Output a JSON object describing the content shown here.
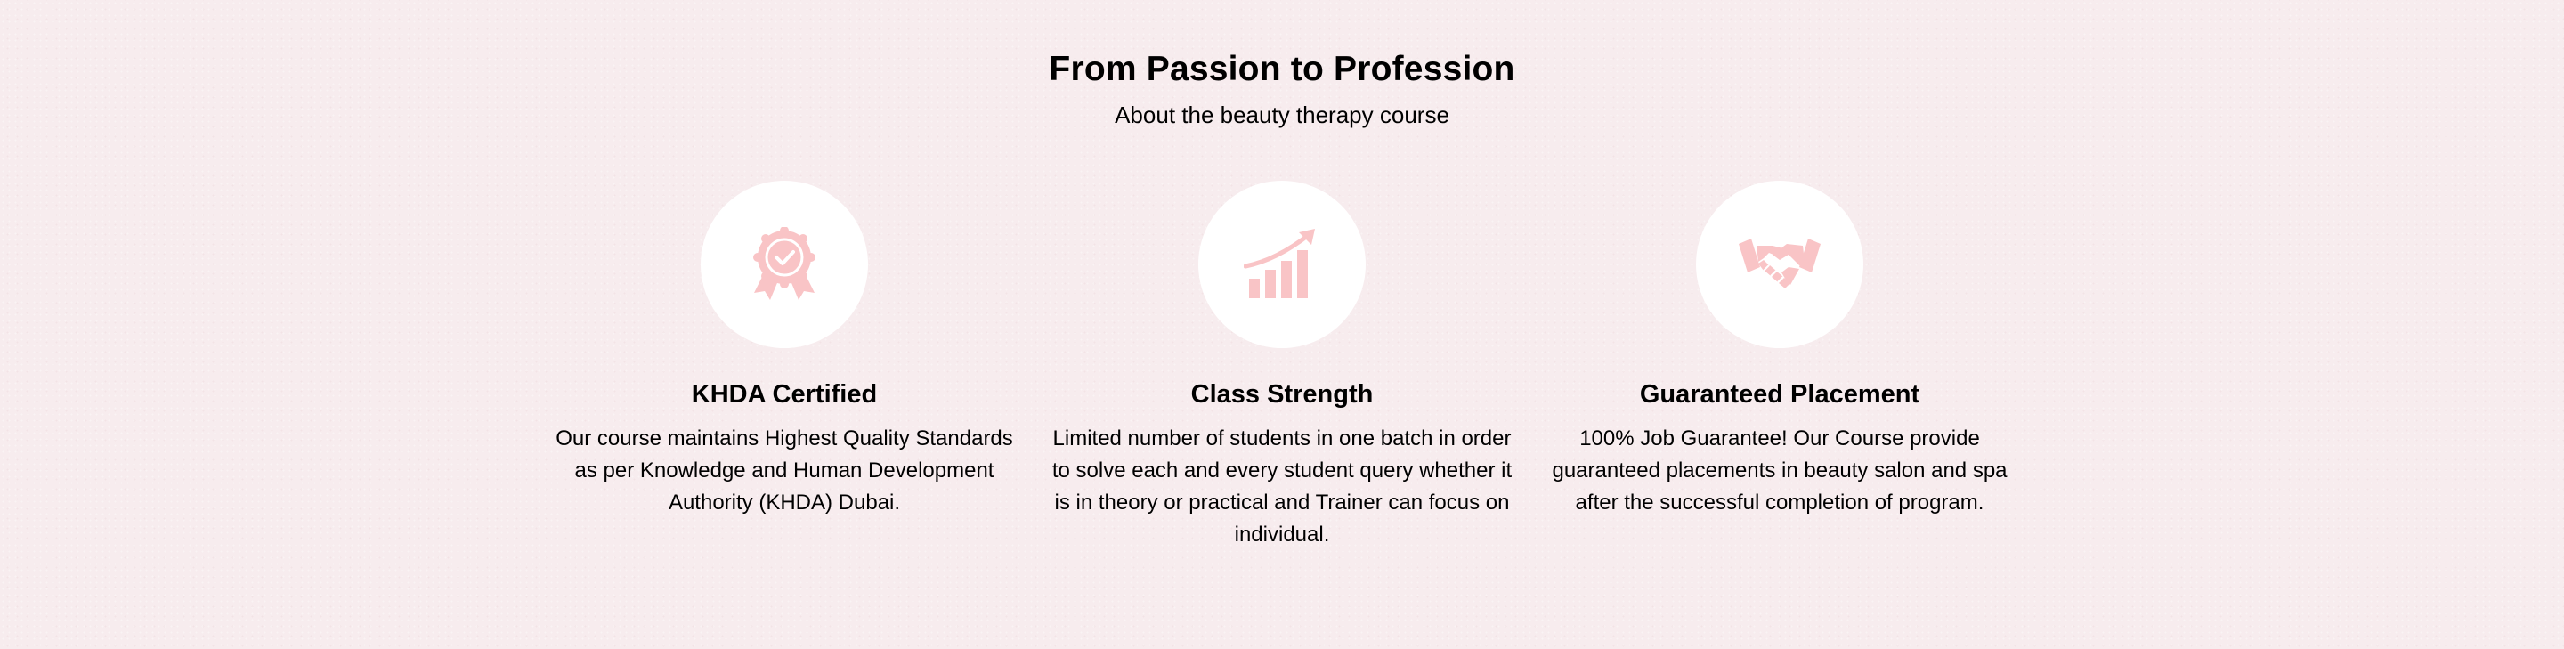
{
  "header": {
    "title": "From Passion to Profession",
    "subtitle": "About the beauty therapy course"
  },
  "features": [
    {
      "icon": "award-badge-icon",
      "title": "KHDA Certified",
      "description": "Our course maintains Highest Quality Standards as per Knowledge and Human Development Authority (KHDA) Dubai."
    },
    {
      "icon": "growth-chart-icon",
      "title": "Class Strength",
      "description": "Limited number of students in one batch in order to solve each and every student query whether it is in theory or practical and Trainer can focus on individual."
    },
    {
      "icon": "handshake-icon",
      "title": "Guaranteed Placement",
      "description": "100% Job Guarantee! Our Course provide guaranteed placements in beauty salon and spa after the successful completion of program."
    }
  ],
  "colors": {
    "background": "#f7ecee",
    "icon_circle": "#ffffff",
    "icon": "#f9c4c6",
    "text": "#000000"
  }
}
